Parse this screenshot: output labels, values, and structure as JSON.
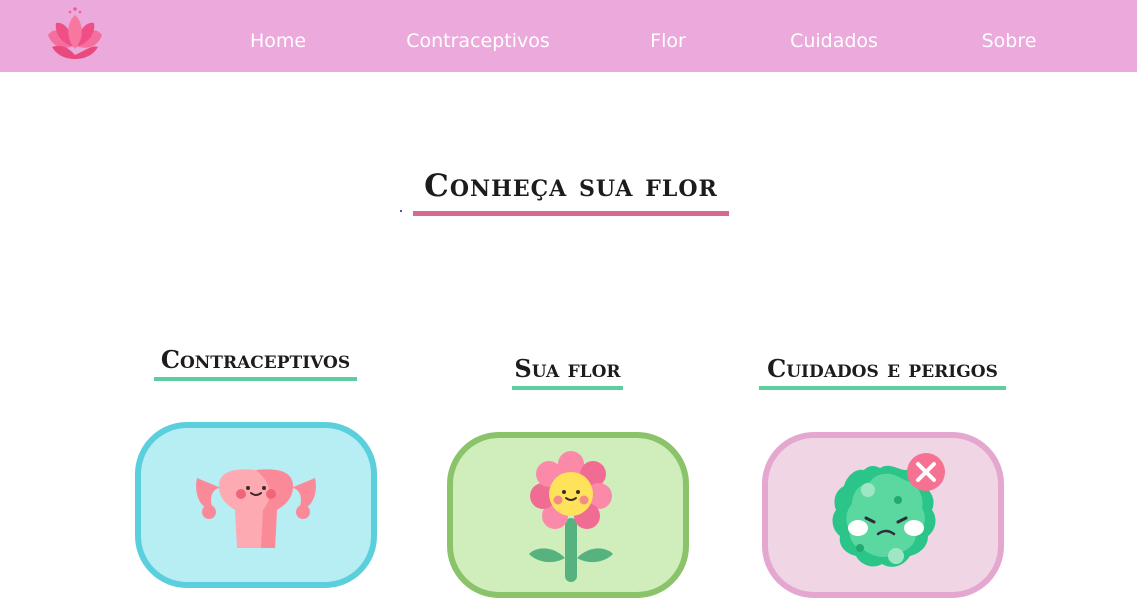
{
  "nav": {
    "logo_icon": "lotus-icon",
    "links": [
      "Home",
      "Contraceptivos",
      "Flor",
      "Cuidados",
      "Sobre"
    ]
  },
  "hero": {
    "title": "Conheça sua flor"
  },
  "sections": [
    {
      "title": "Contraceptivos",
      "icon": "uterus-icon",
      "card_bg": "#b6eef4",
      "card_border": "#5ccfdc"
    },
    {
      "title": "Sua flor",
      "icon": "flower-icon",
      "card_bg": "#d0edbc",
      "card_border": "#8ac36a"
    },
    {
      "title": "Cuidados e perigos",
      "icon": "virus-icon",
      "card_bg": "#f0d5e5",
      "card_border": "#e4a7cf"
    }
  ],
  "colors": {
    "navbar": "#eba9dc",
    "hero_underline": "#d56c8d",
    "section_underline": "#5fce9e"
  }
}
